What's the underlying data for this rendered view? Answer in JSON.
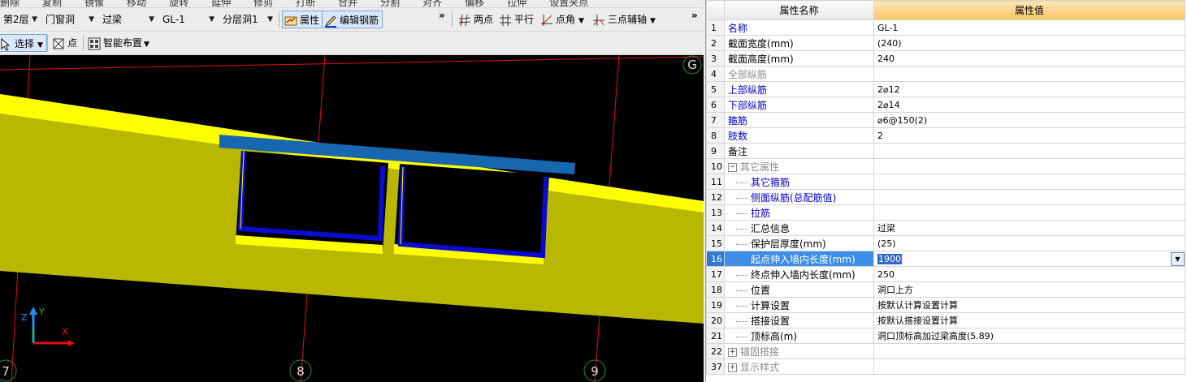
{
  "toolbar_cutoff": [
    "删除",
    "复制",
    "镜像",
    "移动",
    "旋转",
    "延伸",
    "修剪",
    "打断",
    "合并",
    "分割",
    "对齐",
    "偏移",
    "拉伸",
    "设置夹点"
  ],
  "toolbar1": {
    "floor": "第2层",
    "category": "门窗洞",
    "type": "过梁",
    "component": "GL-1",
    "layer": "分层洞1",
    "attr_btn": "属性",
    "edit_rebar_btn": "编辑钢筋",
    "two_point": "两点",
    "parallel": "平行",
    "point_angle": "点角",
    "three_point_axis": "三点辅轴"
  },
  "toolbar2": {
    "select": "选择",
    "point": "点",
    "smart_layout": "智能布置"
  },
  "viewport": {
    "axis_labels": [
      "G",
      "7",
      "8",
      "9"
    ],
    "coord_x": "X",
    "coord_y": "Y",
    "coord_z": "Z",
    "colors": {
      "beam": "#ffff00",
      "wall": "#b8b800",
      "cap": "#1767b0",
      "rebar": "#0b0bd0",
      "grid": "#e01010",
      "bubble": "#2a8c2a"
    }
  },
  "properties": {
    "header_name": "属性名称",
    "header_value": "属性值",
    "rows": [
      {
        "num": "1",
        "name": "名称",
        "value": "GL-1",
        "style": "blue",
        "indent": 0
      },
      {
        "num": "2",
        "name": "截面宽度(mm)",
        "value": "(240)",
        "style": "black",
        "indent": 0
      },
      {
        "num": "3",
        "name": "截面高度(mm)",
        "value": "240",
        "style": "black",
        "indent": 0
      },
      {
        "num": "4",
        "name": "全部纵筋",
        "value": "",
        "style": "gray",
        "indent": 0
      },
      {
        "num": "5",
        "name": "上部纵筋",
        "value": "2⌀12",
        "style": "blue",
        "indent": 0
      },
      {
        "num": "6",
        "name": "下部纵筋",
        "value": "2⌀14",
        "style": "blue",
        "indent": 0
      },
      {
        "num": "7",
        "name": "箍筋",
        "value": "⌀6@150(2)",
        "style": "blue",
        "indent": 0
      },
      {
        "num": "8",
        "name": "肢数",
        "value": "2",
        "style": "blue",
        "indent": 0
      },
      {
        "num": "9",
        "name": "备注",
        "value": "",
        "style": "black",
        "indent": 0
      },
      {
        "num": "10",
        "name": "其它属性",
        "value": "",
        "style": "gray",
        "indent": 0,
        "toggle": "−"
      },
      {
        "num": "11",
        "name": "其它箍筋",
        "value": "",
        "style": "blue",
        "indent": 1
      },
      {
        "num": "12",
        "name": "侧面纵筋(总配筋值)",
        "value": "",
        "style": "blue",
        "indent": 1
      },
      {
        "num": "13",
        "name": "拉筋",
        "value": "",
        "style": "blue",
        "indent": 1
      },
      {
        "num": "14",
        "name": "汇总信息",
        "value": "过梁",
        "style": "black",
        "indent": 1
      },
      {
        "num": "15",
        "name": "保护层厚度(mm)",
        "value": "(25)",
        "style": "black",
        "indent": 1
      },
      {
        "num": "16",
        "name": "起点伸入墙内长度(mm)",
        "value": "1900",
        "style": "black",
        "indent": 1,
        "selected": true
      },
      {
        "num": "17",
        "name": "终点伸入墙内长度(mm)",
        "value": "250",
        "style": "black",
        "indent": 1
      },
      {
        "num": "18",
        "name": "位置",
        "value": "洞口上方",
        "style": "black",
        "indent": 1
      },
      {
        "num": "19",
        "name": "计算设置",
        "value": "按默认计算设置计算",
        "style": "black",
        "indent": 1
      },
      {
        "num": "20",
        "name": "搭接设置",
        "value": "按默认搭接设置计算",
        "style": "black",
        "indent": 1
      },
      {
        "num": "21",
        "name": "顶标高(m)",
        "value": "洞口顶标高加过梁高度(5.89)",
        "style": "black",
        "indent": 1
      },
      {
        "num": "22",
        "name": "锚固搭接",
        "value": "",
        "style": "gray",
        "indent": 0,
        "toggle": "+"
      },
      {
        "num": "37",
        "name": "显示样式",
        "value": "",
        "style": "gray",
        "indent": 0,
        "toggle": "+"
      }
    ]
  }
}
